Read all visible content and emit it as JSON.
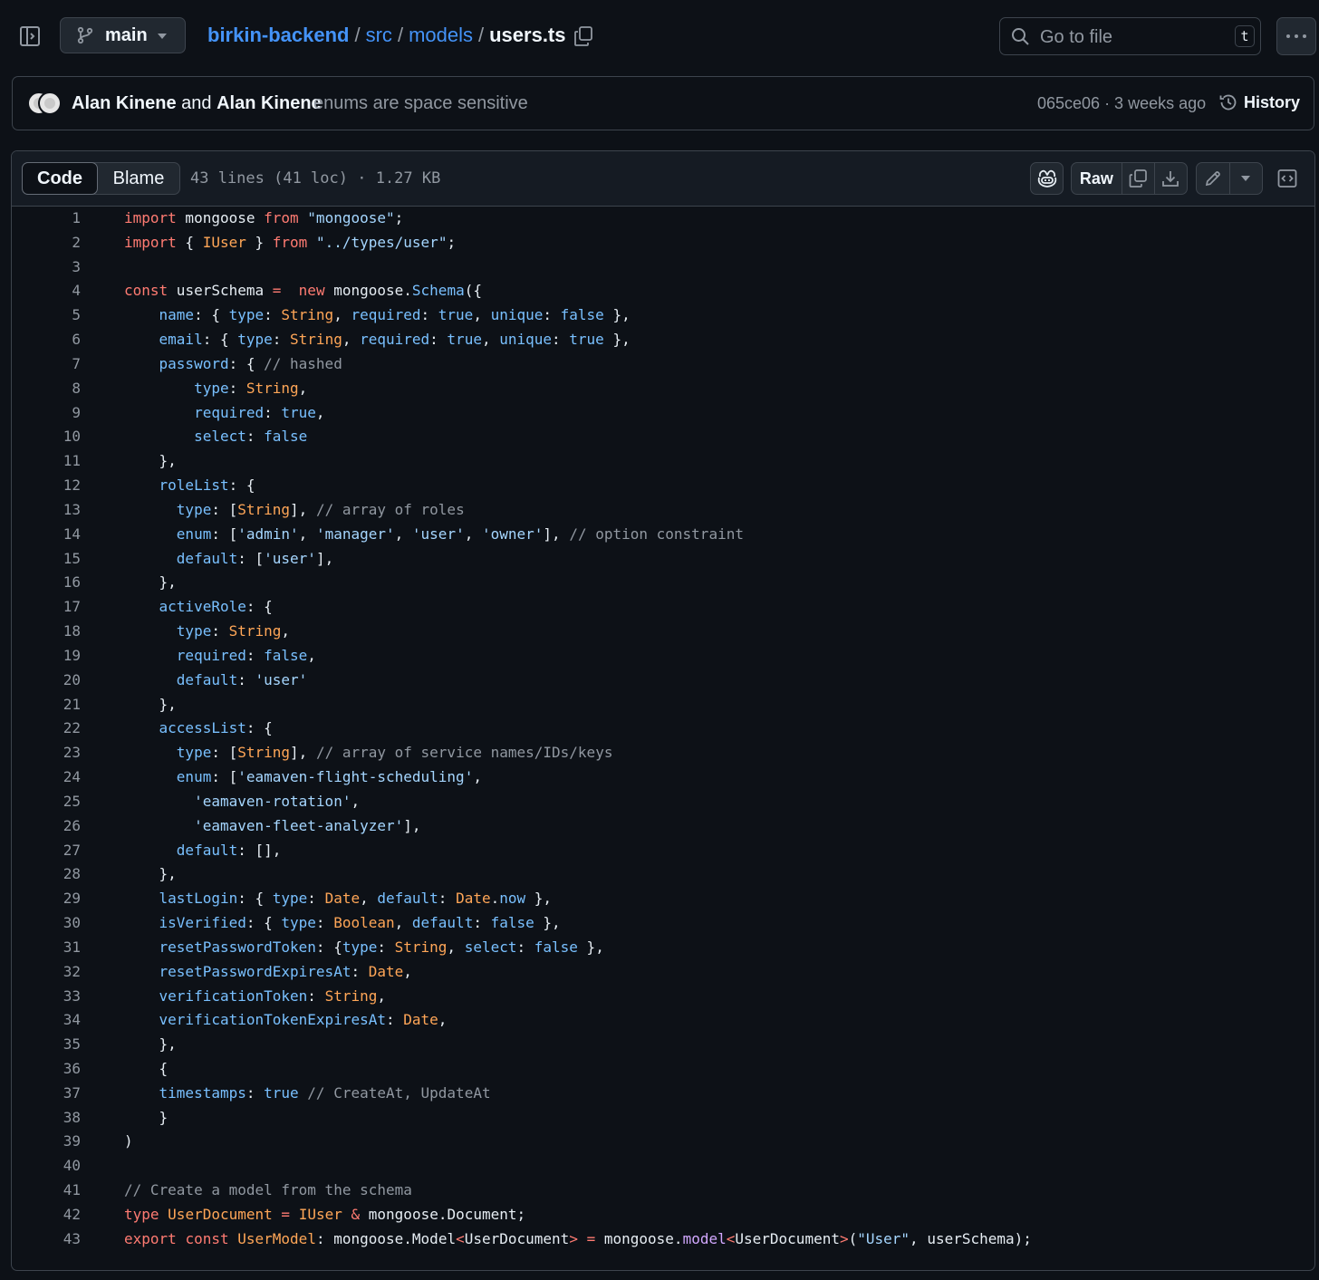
{
  "topbar": {
    "branch": "main",
    "breadcrumb": {
      "repo": "birkin-backend",
      "dir1": "src",
      "dir2": "models",
      "file": "users.ts",
      "sep": "/"
    },
    "search_placeholder": "Go to file",
    "search_shortcut": "t"
  },
  "commit": {
    "author1": "Alan Kinene",
    "and": "and",
    "author2": "Alan Kinene",
    "message": "enums are space sensitive",
    "meta": "065ce06 · 3 weeks ago",
    "history_label": "History"
  },
  "file": {
    "tab_code": "Code",
    "tab_blame": "Blame",
    "info": "43 lines (41 loc) · 1.27 KB",
    "raw_label": "Raw"
  },
  "code_lines": [
    [
      [
        "kw",
        "import"
      ],
      [
        "p",
        " mongoose "
      ],
      [
        "kw",
        "from"
      ],
      [
        "p",
        " "
      ],
      [
        "str",
        "\"mongoose\""
      ],
      [
        "p",
        ";"
      ]
    ],
    [
      [
        "kw",
        "import"
      ],
      [
        "p",
        " { "
      ],
      [
        "type",
        "IUser"
      ],
      [
        "p",
        " } "
      ],
      [
        "kw",
        "from"
      ],
      [
        "p",
        " "
      ],
      [
        "str",
        "\"../types/user\""
      ],
      [
        "p",
        ";"
      ]
    ],
    [],
    [
      [
        "kw",
        "const"
      ],
      [
        "p",
        " userSchema "
      ],
      [
        "kw",
        "="
      ],
      [
        "p",
        "  "
      ],
      [
        "kw",
        "new"
      ],
      [
        "p",
        " mongoose."
      ],
      [
        "prop",
        "Schema"
      ],
      [
        "p",
        "({"
      ]
    ],
    [
      [
        "p",
        "    "
      ],
      [
        "prop",
        "name"
      ],
      [
        "p",
        ": { "
      ],
      [
        "prop",
        "type"
      ],
      [
        "p",
        ": "
      ],
      [
        "type",
        "String"
      ],
      [
        "p",
        ", "
      ],
      [
        "prop",
        "required"
      ],
      [
        "p",
        ": "
      ],
      [
        "prop",
        "true"
      ],
      [
        "p",
        ", "
      ],
      [
        "prop",
        "unique"
      ],
      [
        "p",
        ": "
      ],
      [
        "prop",
        "false"
      ],
      [
        "p",
        " },"
      ]
    ],
    [
      [
        "p",
        "    "
      ],
      [
        "prop",
        "email"
      ],
      [
        "p",
        ": { "
      ],
      [
        "prop",
        "type"
      ],
      [
        "p",
        ": "
      ],
      [
        "type",
        "String"
      ],
      [
        "p",
        ", "
      ],
      [
        "prop",
        "required"
      ],
      [
        "p",
        ": "
      ],
      [
        "prop",
        "true"
      ],
      [
        "p",
        ", "
      ],
      [
        "prop",
        "unique"
      ],
      [
        "p",
        ": "
      ],
      [
        "prop",
        "true"
      ],
      [
        "p",
        " },"
      ]
    ],
    [
      [
        "p",
        "    "
      ],
      [
        "prop",
        "password"
      ],
      [
        "p",
        ": { "
      ],
      [
        "com",
        "// hashed"
      ]
    ],
    [
      [
        "p",
        "        "
      ],
      [
        "prop",
        "type"
      ],
      [
        "p",
        ": "
      ],
      [
        "type",
        "String"
      ],
      [
        "p",
        ","
      ]
    ],
    [
      [
        "p",
        "        "
      ],
      [
        "prop",
        "required"
      ],
      [
        "p",
        ": "
      ],
      [
        "prop",
        "true"
      ],
      [
        "p",
        ","
      ]
    ],
    [
      [
        "p",
        "        "
      ],
      [
        "prop",
        "select"
      ],
      [
        "p",
        ": "
      ],
      [
        "prop",
        "false"
      ]
    ],
    [
      [
        "p",
        "    },"
      ]
    ],
    [
      [
        "p",
        "    "
      ],
      [
        "prop",
        "roleList"
      ],
      [
        "p",
        ": {"
      ]
    ],
    [
      [
        "p",
        "      "
      ],
      [
        "prop",
        "type"
      ],
      [
        "p",
        ": ["
      ],
      [
        "type",
        "String"
      ],
      [
        "p",
        "], "
      ],
      [
        "com",
        "// array of roles"
      ]
    ],
    [
      [
        "p",
        "      "
      ],
      [
        "prop",
        "enum"
      ],
      [
        "p",
        ": ["
      ],
      [
        "str",
        "'admin'"
      ],
      [
        "p",
        ", "
      ],
      [
        "str",
        "'manager'"
      ],
      [
        "p",
        ", "
      ],
      [
        "str",
        "'user'"
      ],
      [
        "p",
        ", "
      ],
      [
        "str",
        "'owner'"
      ],
      [
        "p",
        "], "
      ],
      [
        "com",
        "// option constraint"
      ]
    ],
    [
      [
        "p",
        "      "
      ],
      [
        "prop",
        "default"
      ],
      [
        "p",
        ": ["
      ],
      [
        "str",
        "'user'"
      ],
      [
        "p",
        "],"
      ]
    ],
    [
      [
        "p",
        "    },"
      ]
    ],
    [
      [
        "p",
        "    "
      ],
      [
        "prop",
        "activeRole"
      ],
      [
        "p",
        ": {"
      ]
    ],
    [
      [
        "p",
        "      "
      ],
      [
        "prop",
        "type"
      ],
      [
        "p",
        ": "
      ],
      [
        "type",
        "String"
      ],
      [
        "p",
        ","
      ]
    ],
    [
      [
        "p",
        "      "
      ],
      [
        "prop",
        "required"
      ],
      [
        "p",
        ": "
      ],
      [
        "prop",
        "false"
      ],
      [
        "p",
        ","
      ]
    ],
    [
      [
        "p",
        "      "
      ],
      [
        "prop",
        "default"
      ],
      [
        "p",
        ": "
      ],
      [
        "str",
        "'user'"
      ]
    ],
    [
      [
        "p",
        "    },"
      ]
    ],
    [
      [
        "p",
        "    "
      ],
      [
        "prop",
        "accessList"
      ],
      [
        "p",
        ": {"
      ]
    ],
    [
      [
        "p",
        "      "
      ],
      [
        "prop",
        "type"
      ],
      [
        "p",
        ": ["
      ],
      [
        "type",
        "String"
      ],
      [
        "p",
        "], "
      ],
      [
        "com",
        "// array of service names/IDs/keys"
      ]
    ],
    [
      [
        "p",
        "      "
      ],
      [
        "prop",
        "enum"
      ],
      [
        "p",
        ": ["
      ],
      [
        "str",
        "'eamaven-flight-scheduling'"
      ],
      [
        "p",
        ","
      ]
    ],
    [
      [
        "p",
        "        "
      ],
      [
        "str",
        "'eamaven-rotation'"
      ],
      [
        "p",
        ","
      ]
    ],
    [
      [
        "p",
        "        "
      ],
      [
        "str",
        "'eamaven-fleet-analyzer'"
      ],
      [
        "p",
        "],"
      ]
    ],
    [
      [
        "p",
        "      "
      ],
      [
        "prop",
        "default"
      ],
      [
        "p",
        ": [],"
      ]
    ],
    [
      [
        "p",
        "    },"
      ]
    ],
    [
      [
        "p",
        "    "
      ],
      [
        "prop",
        "lastLogin"
      ],
      [
        "p",
        ": { "
      ],
      [
        "prop",
        "type"
      ],
      [
        "p",
        ": "
      ],
      [
        "type",
        "Date"
      ],
      [
        "p",
        ", "
      ],
      [
        "prop",
        "default"
      ],
      [
        "p",
        ": "
      ],
      [
        "type",
        "Date"
      ],
      [
        "p",
        "."
      ],
      [
        "prop",
        "now"
      ],
      [
        "p",
        " },"
      ]
    ],
    [
      [
        "p",
        "    "
      ],
      [
        "prop",
        "isVerified"
      ],
      [
        "p",
        ": { "
      ],
      [
        "prop",
        "type"
      ],
      [
        "p",
        ": "
      ],
      [
        "type",
        "Boolean"
      ],
      [
        "p",
        ", "
      ],
      [
        "prop",
        "default"
      ],
      [
        "p",
        ": "
      ],
      [
        "prop",
        "false"
      ],
      [
        "p",
        " },"
      ]
    ],
    [
      [
        "p",
        "    "
      ],
      [
        "prop",
        "resetPasswordToken"
      ],
      [
        "p",
        ": {"
      ],
      [
        "prop",
        "type"
      ],
      [
        "p",
        ": "
      ],
      [
        "type",
        "String"
      ],
      [
        "p",
        ", "
      ],
      [
        "prop",
        "select"
      ],
      [
        "p",
        ": "
      ],
      [
        "prop",
        "false"
      ],
      [
        "p",
        " },"
      ]
    ],
    [
      [
        "p",
        "    "
      ],
      [
        "prop",
        "resetPasswordExpiresAt"
      ],
      [
        "p",
        ": "
      ],
      [
        "type",
        "Date"
      ],
      [
        "p",
        ","
      ]
    ],
    [
      [
        "p",
        "    "
      ],
      [
        "prop",
        "verificationToken"
      ],
      [
        "p",
        ": "
      ],
      [
        "type",
        "String"
      ],
      [
        "p",
        ","
      ]
    ],
    [
      [
        "p",
        "    "
      ],
      [
        "prop",
        "verificationTokenExpiresAt"
      ],
      [
        "p",
        ": "
      ],
      [
        "type",
        "Date"
      ],
      [
        "p",
        ","
      ]
    ],
    [
      [
        "p",
        "    },"
      ]
    ],
    [
      [
        "p",
        "    {"
      ]
    ],
    [
      [
        "p",
        "    "
      ],
      [
        "prop",
        "timestamps"
      ],
      [
        "p",
        ": "
      ],
      [
        "prop",
        "true"
      ],
      [
        "p",
        " "
      ],
      [
        "com",
        "// CreateAt, UpdateAt"
      ]
    ],
    [
      [
        "p",
        "    }"
      ]
    ],
    [
      [
        "p",
        ")"
      ]
    ],
    [],
    [
      [
        "com",
        "// Create a model from the schema"
      ]
    ],
    [
      [
        "kw",
        "type"
      ],
      [
        "p",
        " "
      ],
      [
        "type",
        "UserDocument"
      ],
      [
        "p",
        " "
      ],
      [
        "kw",
        "="
      ],
      [
        "p",
        " "
      ],
      [
        "type",
        "IUser"
      ],
      [
        "p",
        " "
      ],
      [
        "kw",
        "&"
      ],
      [
        "p",
        " mongoose.Document;"
      ]
    ],
    [
      [
        "kw",
        "export"
      ],
      [
        "p",
        " "
      ],
      [
        "kw",
        "const"
      ],
      [
        "p",
        " "
      ],
      [
        "type",
        "UserModel"
      ],
      [
        "p",
        ": mongoose.Model"
      ],
      [
        "kw",
        "<"
      ],
      [
        "p",
        "UserDocument"
      ],
      [
        "kw",
        ">"
      ],
      [
        "p",
        " "
      ],
      [
        "kw",
        "="
      ],
      [
        "p",
        " mongoose."
      ],
      [
        "fn",
        "model"
      ],
      [
        "kw",
        "<"
      ],
      [
        "p",
        "UserDocument"
      ],
      [
        "kw",
        ">"
      ],
      [
        "p",
        "("
      ],
      [
        "str",
        "\"User\""
      ],
      [
        "p",
        ", userSchema);"
      ]
    ]
  ]
}
